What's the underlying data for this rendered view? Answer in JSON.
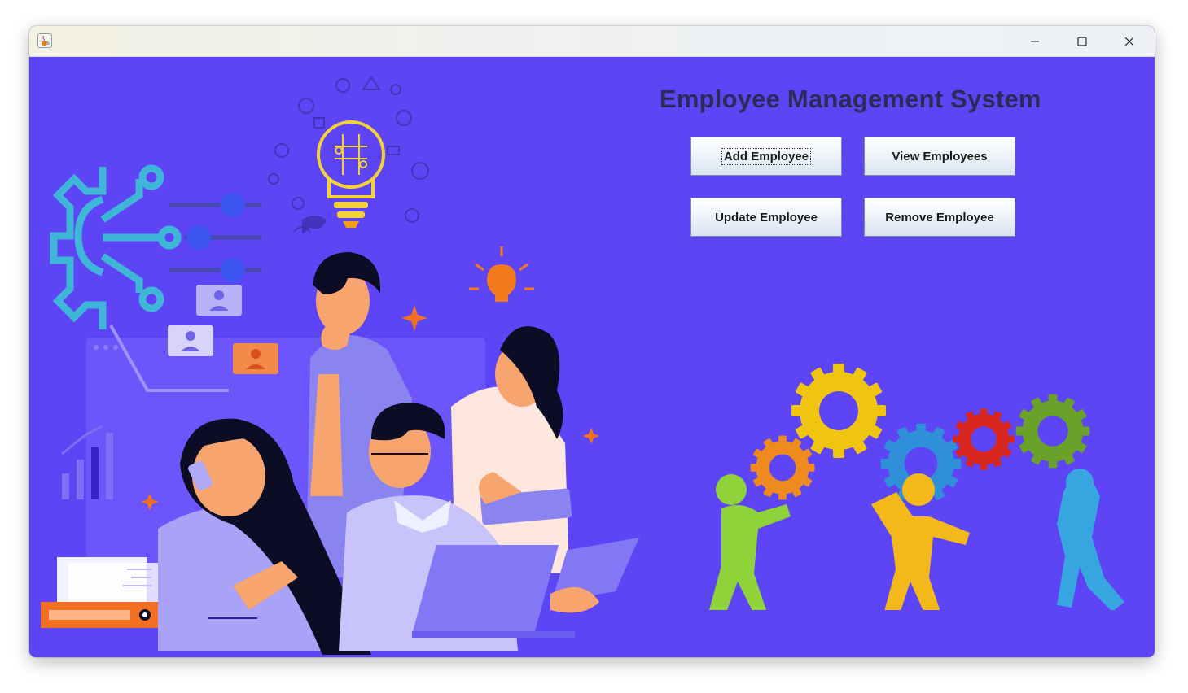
{
  "window": {
    "app_icon": "java-cup-icon",
    "controls": {
      "minimize": "minimize-icon",
      "maximize": "maximize-icon",
      "close": "close-icon"
    }
  },
  "main": {
    "title": "Employee Management System",
    "buttons": {
      "add": "Add Employee",
      "view": "View Employees",
      "update": "Update Employee",
      "remove": "Remove Employee"
    },
    "background_color": "#5d45f5",
    "title_color": "#2e2a57"
  },
  "illustrations": {
    "left": "team-brainstorm-illustration",
    "right": "teamwork-gears-illustration"
  }
}
